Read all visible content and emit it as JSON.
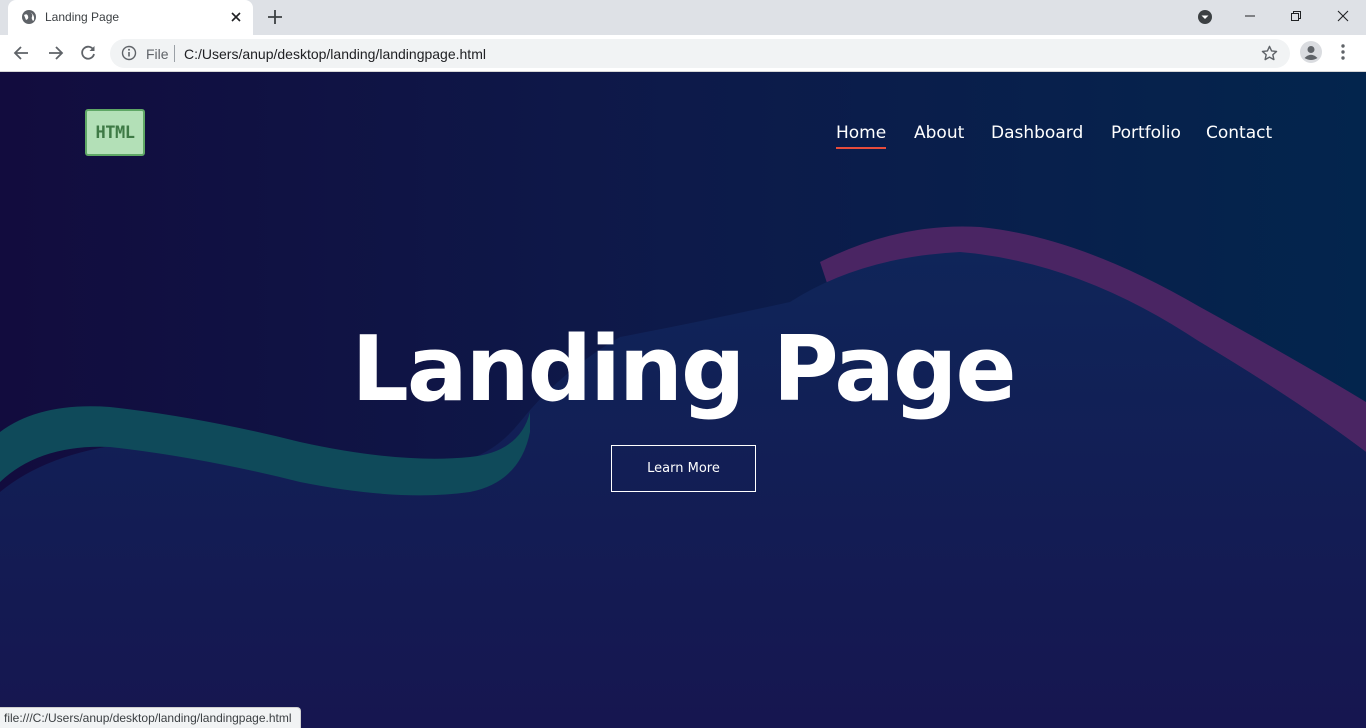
{
  "browser": {
    "tab_title": "Landing Page",
    "address_scheme": "File",
    "address_url": "C:/Users/anup/desktop/landing/landingpage.html",
    "status_url": "file:///C:/Users/anup/desktop/landing/landingpage.html"
  },
  "page": {
    "logo_text": "HTML",
    "nav": [
      {
        "label": "Home",
        "active": true
      },
      {
        "label": "About",
        "active": false
      },
      {
        "label": "Dashboard",
        "active": false
      },
      {
        "label": "Portfolio",
        "active": false
      },
      {
        "label": "Contact",
        "active": false
      }
    ],
    "hero_title": "Landing Page",
    "cta_label": "Learn More"
  },
  "colors": {
    "bg_left": "#120c3e",
    "bg_right": "#03254d",
    "nav_active_underline": "#e74c3c",
    "wave_teal": "#0f4a5a",
    "wave_purple": "#4a2563",
    "wave_blue": "#0f2a5c"
  }
}
